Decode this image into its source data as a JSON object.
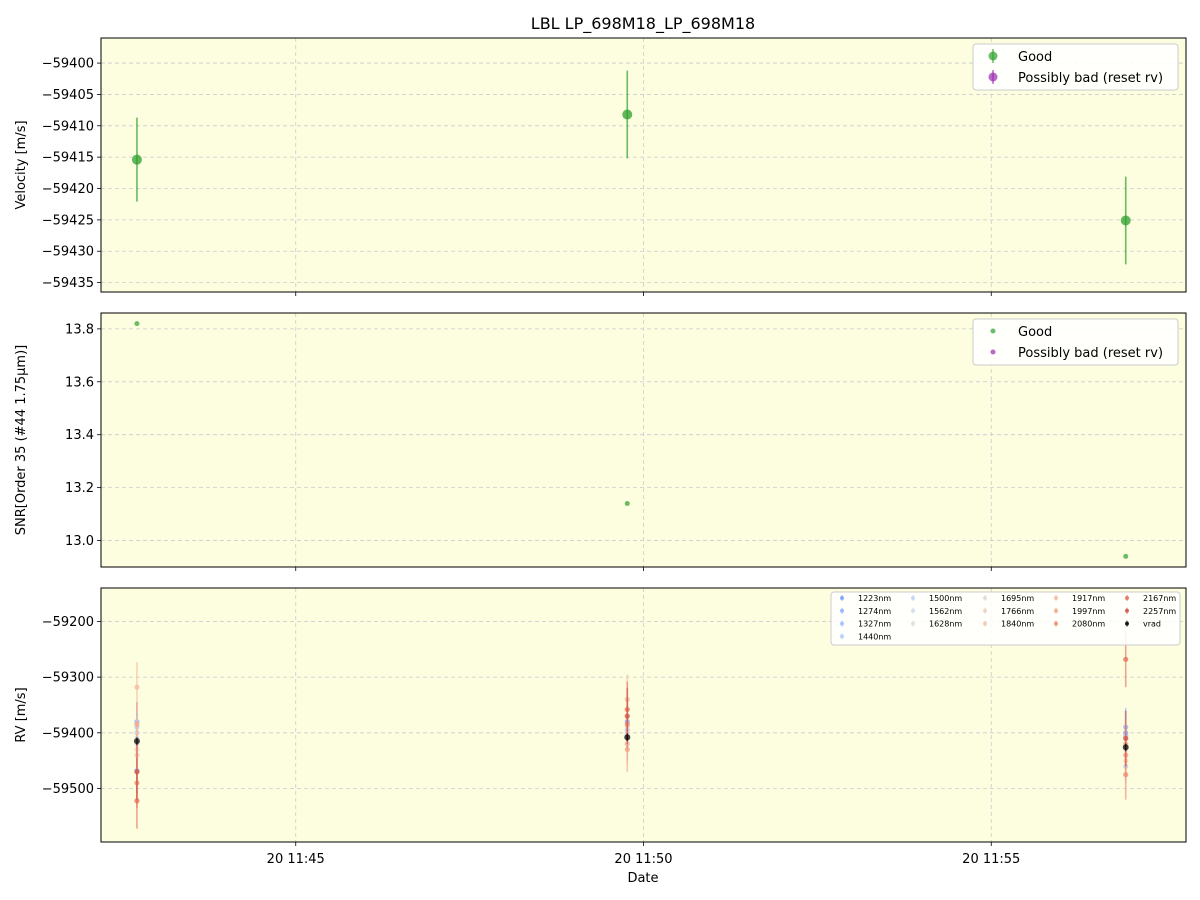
{
  "figure": {
    "title": "LBL LP_698M18_LP_698M18",
    "xlabel": "Date",
    "x_ticks": [
      "20 11:45",
      "20 11:50",
      "20 11:55"
    ]
  },
  "chart_data": [
    {
      "type": "scatter",
      "panel": "velocity",
      "ylabel": "Velocity [m/s]",
      "ylim": [
        -59436.5,
        -59396.0
      ],
      "y_ticks": [
        -59400,
        -59405,
        -59410,
        -59415,
        -59420,
        -59425,
        -59430,
        -59435
      ],
      "x_ticks": [
        "20 11:45",
        "20 11:50",
        "20 11:55"
      ],
      "xlim_minutes": [
        42.2,
        57.8
      ],
      "grid": true,
      "legend_position": "upper right",
      "series": [
        {
          "name": "Good",
          "color": "#2ca02c",
          "points": [
            {
              "x": "11:42:43",
              "y": -59415.4,
              "err": 6.7
            },
            {
              "x": "11:49:46",
              "y": -59408.2,
              "err": 7.0
            },
            {
              "x": "11:56:56",
              "y": -59425.1,
              "err": 7.0
            }
          ]
        },
        {
          "name": "Possibly bad (reset rv)",
          "color": "#9c27b0",
          "points": []
        }
      ]
    },
    {
      "type": "scatter",
      "panel": "snr",
      "ylabel": "SNR[Order 35 (#44 1.75$\\mu$m)]",
      "ylim": [
        12.9,
        13.86
      ],
      "y_ticks": [
        13.0,
        13.2,
        13.4,
        13.6,
        13.8
      ],
      "y_tick_labels": [
        "13.0",
        "13.2",
        "13.4",
        "13.6",
        "13.8"
      ],
      "grid": true,
      "legend_position": "upper right",
      "series": [
        {
          "name": "Good",
          "color": "#2ca02c",
          "points": [
            {
              "x": "11:42:43",
              "y": 13.82
            },
            {
              "x": "11:49:46",
              "y": 13.14
            },
            {
              "x": "11:56:56",
              "y": 12.94
            }
          ]
        },
        {
          "name": "Possibly bad (reset rv)",
          "color": "#9c27b0",
          "points": []
        }
      ]
    },
    {
      "type": "scatter",
      "panel": "rv",
      "ylabel": "RV [m/s]",
      "ylim": [
        -59596,
        -59140
      ],
      "y_ticks": [
        -59200,
        -59300,
        -59400,
        -59500
      ],
      "grid": true,
      "legend_position": "upper right",
      "series": [
        {
          "name": "1223nm",
          "color": "#7b9ff9",
          "points": [
            {
              "x": "11:42:43",
              "y": -59468,
              "err": 40
            },
            {
              "x": "11:49:46",
              "y": -59380,
              "err": 40
            },
            {
              "x": "11:56:56",
              "y": -59400,
              "err": 40
            }
          ]
        },
        {
          "name": "1274nm",
          "color": "#8db0fe",
          "points": [
            {
              "x": "11:42:43",
              "y": -59380,
              "err": 35
            },
            {
              "x": "11:49:46",
              "y": -59410,
              "err": 35
            },
            {
              "x": "11:56:56",
              "y": -59390,
              "err": 35
            }
          ]
        },
        {
          "name": "1327nm",
          "color": "#9ebeff",
          "points": [
            {
              "x": "11:42:43",
              "y": -59400,
              "err": 35
            },
            {
              "x": "11:49:46",
              "y": -59395,
              "err": 35
            },
            {
              "x": "11:56:56",
              "y": -59405,
              "err": 35
            }
          ]
        },
        {
          "name": "1440nm",
          "color": "#b2ccfb",
          "points": [
            {
              "x": "11:42:43",
              "y": -59390,
              "err": 30
            },
            {
              "x": "11:49:46",
              "y": -59420,
              "err": 30
            },
            {
              "x": "11:56:56",
              "y": -59460,
              "err": 30
            }
          ]
        },
        {
          "name": "1500nm",
          "color": "#c0d4f5",
          "points": [
            {
              "x": "11:42:43",
              "y": -59410,
              "err": 30
            },
            {
              "x": "11:49:46",
              "y": -59400,
              "err": 30
            },
            {
              "x": "11:56:56",
              "y": -59410,
              "err": 30
            }
          ]
        },
        {
          "name": "1562nm",
          "color": "#cfdaea",
          "points": [
            {
              "x": "11:42:43",
              "y": -59420,
              "err": 30
            },
            {
              "x": "11:49:46",
              "y": -59405,
              "err": 30
            },
            {
              "x": "11:56:56",
              "y": -59420,
              "err": 30
            }
          ]
        },
        {
          "name": "1628nm",
          "color": "#dcdddd",
          "points": [
            {
              "x": "11:42:43",
              "y": -59415,
              "err": 30
            },
            {
              "x": "11:49:46",
              "y": -59390,
              "err": 30
            },
            {
              "x": "11:56:56",
              "y": -59430,
              "err": 30
            }
          ]
        },
        {
          "name": "1695nm",
          "color": "#e4d9d2",
          "points": [
            {
              "x": "11:42:43",
              "y": -59400,
              "err": 30
            },
            {
              "x": "11:49:46",
              "y": -59400,
              "err": 30
            },
            {
              "x": "11:56:56",
              "y": -59440,
              "err": 30
            }
          ]
        },
        {
          "name": "1766nm",
          "color": "#efcfbf",
          "points": [
            {
              "x": "11:42:43",
              "y": -59430,
              "err": 30
            },
            {
              "x": "11:49:46",
              "y": -59410,
              "err": 30
            },
            {
              "x": "11:56:56",
              "y": -59420,
              "err": 30
            }
          ]
        },
        {
          "name": "1840nm",
          "color": "#f5c4ac",
          "points": [
            {
              "x": "11:42:43",
              "y": -59440,
              "err": 35
            },
            {
              "x": "11:49:46",
              "y": -59420,
              "err": 35
            },
            {
              "x": "11:56:56",
              "y": -59450,
              "err": 35
            }
          ]
        },
        {
          "name": "1917nm",
          "color": "#f7b89c",
          "points": [
            {
              "x": "11:42:43",
              "y": -59318,
              "err": 45
            },
            {
              "x": "11:49:46",
              "y": -59340,
              "err": 45
            },
            {
              "x": "11:56:56",
              "y": -59420,
              "err": 45
            }
          ]
        },
        {
          "name": "1997nm",
          "color": "#f6a385",
          "points": [
            {
              "x": "11:42:43",
              "y": -59385,
              "err": 40
            },
            {
              "x": "11:49:46",
              "y": -59430,
              "err": 40
            },
            {
              "x": "11:56:56",
              "y": -59440,
              "err": 40
            }
          ]
        },
        {
          "name": "2080nm",
          "color": "#ef8a6c",
          "points": [
            {
              "x": "11:42:43",
              "y": -59490,
              "err": 45
            },
            {
              "x": "11:49:46",
              "y": -59385,
              "err": 45
            },
            {
              "x": "11:56:56",
              "y": -59475,
              "err": 45
            }
          ]
        },
        {
          "name": "2167nm",
          "color": "#e46e56",
          "points": [
            {
              "x": "11:42:43",
              "y": -59522,
              "err": 50
            },
            {
              "x": "11:49:46",
              "y": -59358,
              "err": 50
            },
            {
              "x": "11:56:56",
              "y": -59268,
              "err": 50
            }
          ]
        },
        {
          "name": "2257nm",
          "color": "#d55042",
          "points": [
            {
              "x": "11:42:43",
              "y": -59470,
              "err": 50
            },
            {
              "x": "11:49:46",
              "y": -59370,
              "err": 50
            },
            {
              "x": "11:56:56",
              "y": -59410,
              "err": 50
            }
          ]
        },
        {
          "name": "vrad",
          "color": "#000000",
          "points": [
            {
              "x": "11:42:43",
              "y": -59415,
              "err": 7
            },
            {
              "x": "11:49:46",
              "y": -59408,
              "err": 7
            },
            {
              "x": "11:56:56",
              "y": -59426,
              "err": 7
            }
          ]
        }
      ]
    }
  ]
}
